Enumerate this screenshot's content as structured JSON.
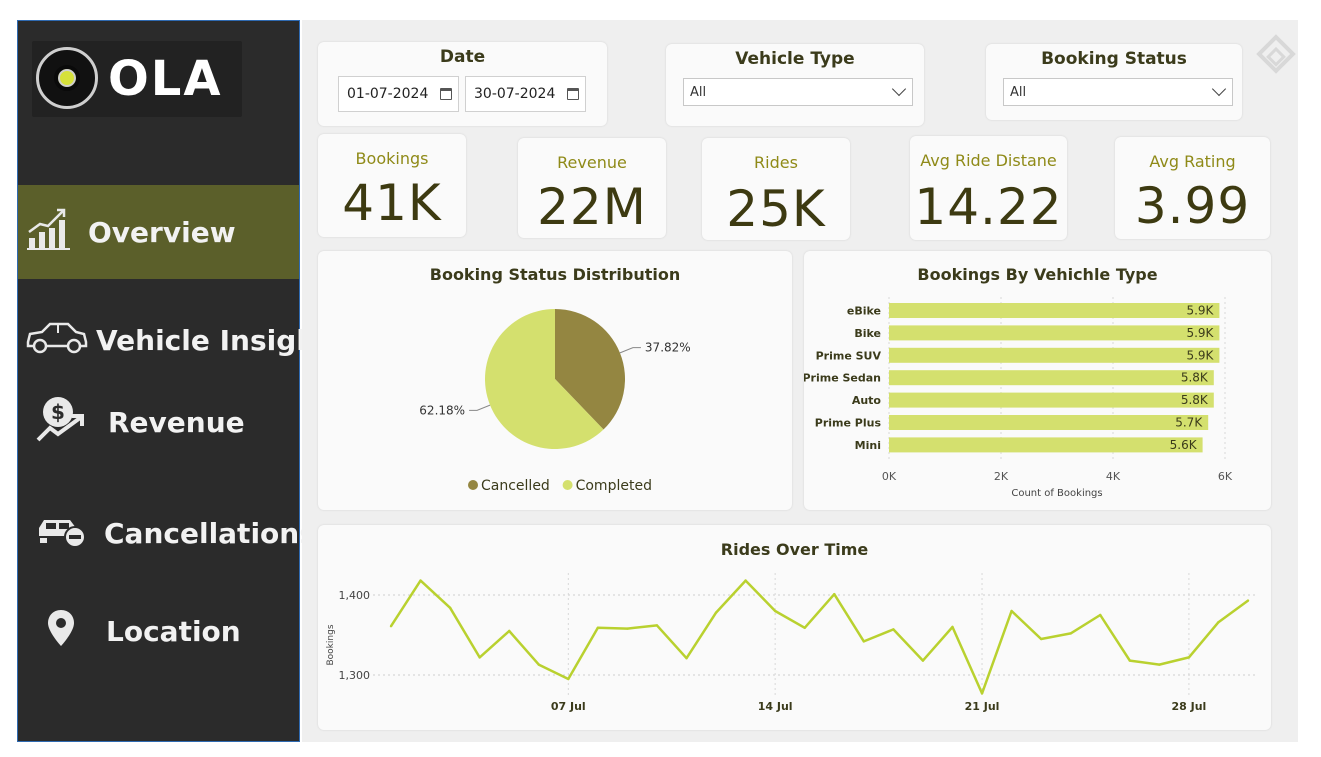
{
  "brand": {
    "logo_text": "OLA"
  },
  "nav": {
    "items": [
      {
        "label": "Overview",
        "icon": "bar-chart-growth-icon",
        "active": true
      },
      {
        "label": "Vehicle Insights",
        "icon": "car-icon",
        "active": false
      },
      {
        "label": "Revenue",
        "icon": "dollar-growth-icon",
        "active": false
      },
      {
        "label": "Cancellations",
        "icon": "car-cancel-icon",
        "active": false
      },
      {
        "label": "Location",
        "icon": "map-pin-icon",
        "active": false
      }
    ]
  },
  "filters": {
    "date": {
      "title": "Date",
      "start": "01-07-2024",
      "end": "30-07-2024"
    },
    "vehicle_type": {
      "title": "Vehicle Type",
      "selected": "All"
    },
    "booking_status": {
      "title": "Booking Status",
      "selected": "All"
    }
  },
  "kpis": [
    {
      "label": "Bookings",
      "value": "41K"
    },
    {
      "label": "Revenue",
      "value": "22M"
    },
    {
      "label": "Rides",
      "value": "25K"
    },
    {
      "label": "Avg Ride Distane",
      "value": "14.22"
    },
    {
      "label": "Avg Rating",
      "value": "3.99"
    }
  ],
  "colors": {
    "accent_dark": "#948641",
    "accent_light": "#d4e06e",
    "active_nav": "#5b5f2a",
    "line": "#b9d12f"
  },
  "chart_data": [
    {
      "type": "pie",
      "title": "Booking Status Distribution",
      "slices": [
        {
          "name": "Cancelled",
          "value": 37.82,
          "label": "37.82%",
          "color": "#948641"
        },
        {
          "name": "Completed",
          "value": 62.18,
          "label": "62.18%",
          "color": "#d4e06e"
        }
      ],
      "legend": "bottom"
    },
    {
      "type": "bar",
      "orientation": "horizontal",
      "title": "Bookings By Vehichle Type",
      "xlabel": "Count of Bookings",
      "ylabel": "",
      "categories": [
        "eBike",
        "Bike",
        "Prime SUV",
        "Prime Sedan",
        "Auto",
        "Prime Plus",
        "Mini"
      ],
      "values": [
        5900,
        5900,
        5900,
        5800,
        5800,
        5700,
        5600
      ],
      "value_labels": [
        "5.9K",
        "5.9K",
        "5.9K",
        "5.8K",
        "5.8K",
        "5.7K",
        "5.6K"
      ],
      "xlim": [
        0,
        6000
      ],
      "xticks": [
        "0K",
        "2K",
        "4K",
        "6K"
      ],
      "grid": true
    },
    {
      "type": "line",
      "title": "Rides Over Time",
      "xlabel": "",
      "ylabel": "Bookings",
      "x": [
        "2024-07-01",
        "2024-07-02",
        "2024-07-03",
        "2024-07-04",
        "2024-07-05",
        "2024-07-06",
        "2024-07-07",
        "2024-07-08",
        "2024-07-09",
        "2024-07-10",
        "2024-07-11",
        "2024-07-12",
        "2024-07-13",
        "2024-07-14",
        "2024-07-15",
        "2024-07-16",
        "2024-07-17",
        "2024-07-18",
        "2024-07-19",
        "2024-07-20",
        "2024-07-21",
        "2024-07-22",
        "2024-07-23",
        "2024-07-24",
        "2024-07-25",
        "2024-07-26",
        "2024-07-27",
        "2024-07-28",
        "2024-07-29",
        "2024-07-30"
      ],
      "values": [
        1361,
        1418,
        1384,
        1322,
        1355,
        1313,
        1295,
        1359,
        1358,
        1362,
        1321,
        1378,
        1418,
        1380,
        1359,
        1401,
        1342,
        1357,
        1318,
        1360,
        1277,
        1380,
        1345,
        1352,
        1375,
        1318,
        1313,
        1322,
        1366,
        1393
      ],
      "xticks": [
        "07 Jul",
        "14 Jul",
        "21 Jul",
        "28 Jul"
      ],
      "yticks": [
        "1,300",
        "1,400"
      ],
      "ylim": [
        1250,
        1450
      ],
      "grid": true
    }
  ]
}
